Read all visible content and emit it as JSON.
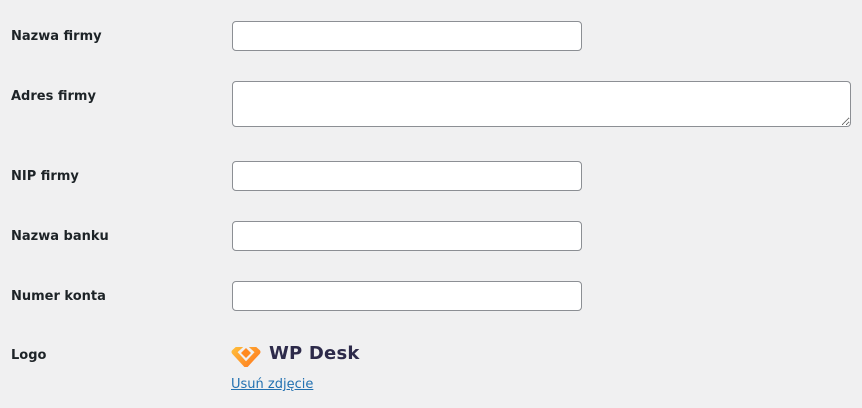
{
  "form": {
    "company_name": {
      "label": "Nazwa firmy",
      "value": ""
    },
    "company_address": {
      "label": "Adres firmy",
      "value": ""
    },
    "company_nip": {
      "label": "NIP firmy",
      "value": ""
    },
    "bank_name": {
      "label": "Nazwa banku",
      "value": ""
    },
    "account_number": {
      "label": "Numer konta",
      "value": ""
    },
    "logo": {
      "label": "Logo",
      "brand_text": "WP Desk",
      "remove_label": "Usuń zdjęcie",
      "logo_colors": [
        "#ffb52b",
        "#ff7a1f"
      ]
    }
  }
}
